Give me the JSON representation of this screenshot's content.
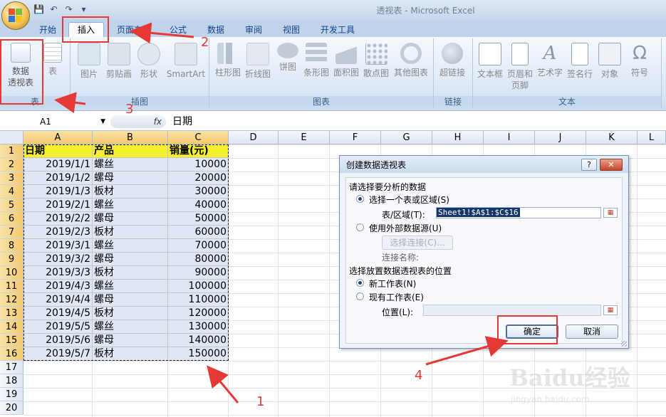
{
  "window": {
    "title": "透视表 - Microsoft Excel"
  },
  "quick_access": [
    "save-icon",
    "undo-icon",
    "redo-icon",
    "customize-icon"
  ],
  "ribbon": {
    "tabs": [
      {
        "label": "开始"
      },
      {
        "label": "插入"
      },
      {
        "label": "页面布局"
      },
      {
        "label": "公式"
      },
      {
        "label": "数据"
      },
      {
        "label": "审阅"
      },
      {
        "label": "视图"
      },
      {
        "label": "开发工具"
      }
    ],
    "active_tab": "插入",
    "groups": {
      "tables": {
        "label": "表",
        "pivot_line1": "数据",
        "pivot_line2": "透视表",
        "table": "表"
      },
      "illustrations": {
        "label": "插图",
        "picture": "图片",
        "clipart": "剪贴画",
        "shapes": "形状",
        "smartart": "SmartArt"
      },
      "charts": {
        "label": "图表",
        "column": "柱形图",
        "line": "折线图",
        "pie": "饼图",
        "bar": "条形图",
        "area": "面积图",
        "scatter": "散点图",
        "other": "其他图表"
      },
      "links": {
        "label": "链接",
        "hyperlink": "超链接"
      },
      "text": {
        "label": "文本",
        "textbox": "文本框",
        "headerfooter_line1": "页眉和",
        "headerfooter_line2": "页脚",
        "wordart": "艺术字",
        "signature": "签名行",
        "object": "对象",
        "symbol": "符号"
      }
    }
  },
  "formula_bar": {
    "name_box": "A1",
    "fx": "fx",
    "content": "日期"
  },
  "sheet": {
    "columns": [
      "A",
      "B",
      "C",
      "D",
      "E",
      "F",
      "G",
      "H",
      "I",
      "J",
      "K",
      "L"
    ],
    "row_numbers": [
      "1",
      "2",
      "3",
      "4",
      "5",
      "6",
      "7",
      "8",
      "9",
      "10",
      "11",
      "12",
      "13",
      "14",
      "15",
      "16",
      "17",
      "18",
      "19",
      "20"
    ],
    "header": [
      "日期",
      "产品",
      "销量(元)"
    ],
    "rows": [
      [
        "2019/1/1",
        "螺丝",
        "10000"
      ],
      [
        "2019/1/2",
        "螺母",
        "20000"
      ],
      [
        "2019/1/3",
        "板材",
        "30000"
      ],
      [
        "2019/2/1",
        "螺丝",
        "40000"
      ],
      [
        "2019/2/2",
        "螺母",
        "50000"
      ],
      [
        "2019/2/3",
        "板材",
        "60000"
      ],
      [
        "2019/3/1",
        "螺丝",
        "70000"
      ],
      [
        "2019/3/2",
        "螺母",
        "80000"
      ],
      [
        "2019/3/3",
        "板材",
        "90000"
      ],
      [
        "2019/4/3",
        "螺丝",
        "100000"
      ],
      [
        "2019/4/4",
        "螺母",
        "110000"
      ],
      [
        "2019/4/5",
        "板材",
        "120000"
      ],
      [
        "2019/5/5",
        "螺丝",
        "130000"
      ],
      [
        "2019/5/6",
        "螺母",
        "140000"
      ],
      [
        "2019/5/7",
        "板材",
        "150000"
      ]
    ]
  },
  "dialog": {
    "title": "创建数据透视表",
    "help": "?",
    "close": "✕",
    "section1": "请选择要分析的数据",
    "option_table": "选择一个表或区域(S)",
    "range_label": "表/区域(T):",
    "range_value": "Sheet1!$A$1:$C$16",
    "option_external": "使用外部数据源(U)",
    "choose_connection": "选择连接(C)...",
    "connection_name": "连接名称:",
    "section2": "选择放置数据透视表的位置",
    "option_new": "新工作表(N)",
    "option_existing": "现有工作表(E)",
    "location_label": "位置(L):",
    "location_value": "",
    "ok": "确定",
    "cancel": "取消"
  },
  "annotations": {
    "n1": "1",
    "n2": "2",
    "n3": "3",
    "n4": "4"
  },
  "watermark": {
    "text": "Baidu经验",
    "url": "jingyan.baidu.com"
  },
  "colors": {
    "header_fill": "#f5ef2e",
    "data_fill": "#dfe6f4",
    "annotation": "#e53935",
    "ribbon": "#dce8f6"
  }
}
